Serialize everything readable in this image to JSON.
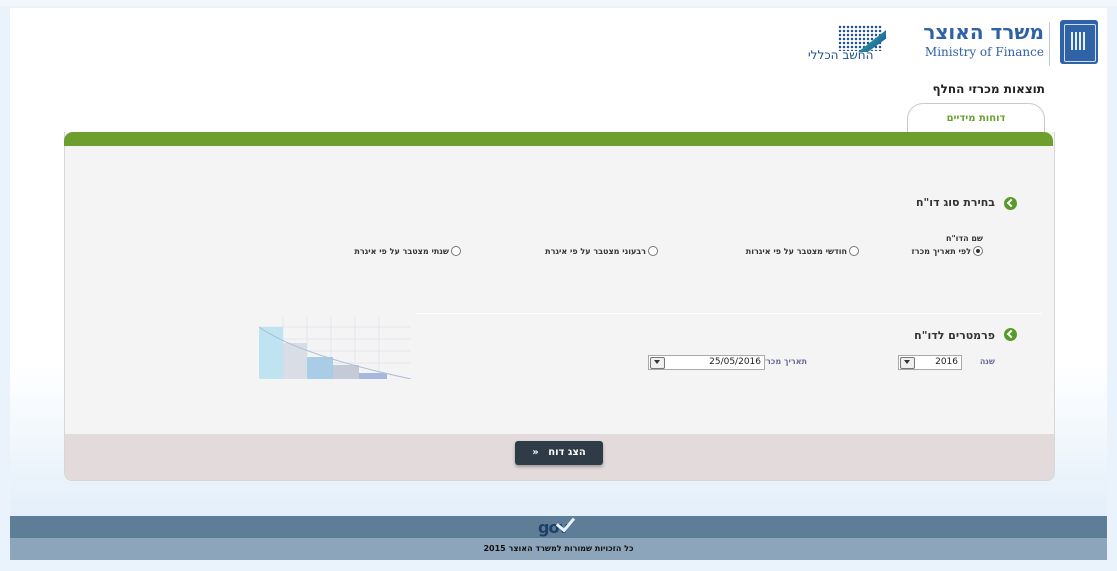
{
  "header": {
    "ministry_he": "משרד האוצר",
    "ministry_en": "Ministry of Finance",
    "accountant_general": "החשב הכללי",
    "page_title": "תוצאות מכרזי החלף"
  },
  "tabs": [
    {
      "label": "דוחות מידיים",
      "active": true
    }
  ],
  "report_type": {
    "section_title": "בחירת סוג דו\"ח",
    "field_label": "שם הדו\"ח",
    "options": [
      {
        "label": "לפי תאריך מכרז",
        "selected": true
      },
      {
        "label": "חודשי מצטבר על פי איגרות",
        "selected": false
      },
      {
        "label": "רבעוני מצטבר על פי איגרת",
        "selected": false
      },
      {
        "label": "שנתי מצטבר על פי איגרת",
        "selected": false
      }
    ]
  },
  "parameters": {
    "section_title": "פרמטרים לדו\"ח",
    "year_label": "שנה",
    "year_value": "2016",
    "date_label": "תאריך מכרז",
    "date_value": "25/05/2016"
  },
  "actions": {
    "show_report_label": "הצג דוח",
    "show_report_arrow": "«"
  },
  "footer": {
    "gov_logo": "gov",
    "copyright": "כל הזכויות שמורות למשרד האוצר 2015"
  },
  "colors": {
    "brand_blue": "#2f62a6",
    "green_bar": "#6e9e2d",
    "button_dark": "#2f3b46",
    "footer_dark": "#5e7d97",
    "footer_light": "#8da5ba"
  }
}
